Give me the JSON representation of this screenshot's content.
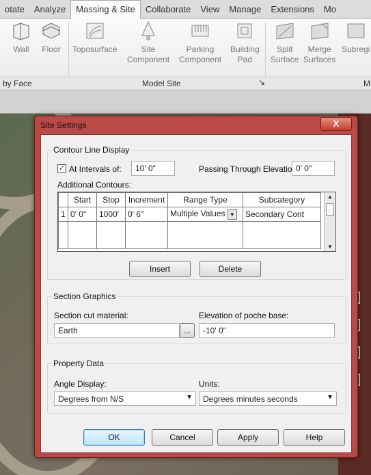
{
  "ribbon": {
    "tabs": [
      "otate",
      "Analyze",
      "Massing & Site",
      "Collaborate",
      "View",
      "Manage",
      "Extensions",
      "Mo"
    ],
    "buttons": {
      "wall": [
        "Wall",
        ""
      ],
      "floor": [
        "Floor",
        ""
      ],
      "toposurface": [
        "Toposurface",
        ""
      ],
      "site_component": [
        "Site",
        "Component"
      ],
      "parking_component": [
        "Parking",
        "Component"
      ],
      "building_pad": [
        "Building",
        "Pad"
      ],
      "split_surface": [
        "Split",
        "Surface"
      ],
      "merge_surfaces": [
        "Merge",
        "Surfaces"
      ],
      "subregion": [
        "Subregi",
        ""
      ]
    },
    "panels": {
      "by_face": "by Face",
      "model_site": "Model Site",
      "m": "M"
    }
  },
  "dialog": {
    "title": "Site Settings",
    "close": "X",
    "contour": {
      "group_title": "Contour Line Display",
      "at_intervals_checked": "✓",
      "at_intervals_label": "At Intervals of:",
      "interval_value": "10'  0\"",
      "passing_label": "Passing Through Elevation:",
      "passing_value": "0'  0\"",
      "additional_label": "Additional Contours:",
      "table": {
        "headers": [
          "",
          "Start",
          "Stop",
          "Increment",
          "Range Type",
          "Subcategory"
        ],
        "row": [
          "1",
          "0'  0\"",
          "1000'",
          "0'  6\"",
          "Multiple Values",
          "Secondary Cont"
        ]
      },
      "insert": "Insert",
      "delete": "Delete"
    },
    "section": {
      "group_title": "Section Graphics",
      "cut_label": "Section cut material:",
      "cut_value": "Earth",
      "browse": "...",
      "poche_label": "Elevation of poche base:",
      "poche_value": "-10'  0\""
    },
    "property": {
      "group_title": "Property Data",
      "angle_label": "Angle Display:",
      "angle_value": "Degrees from N/S",
      "units_label": "Units:",
      "units_value": "Degrees minutes seconds"
    },
    "buttons": {
      "ok": "OK",
      "cancel": "Cancel",
      "apply": "Apply",
      "help": "Help"
    }
  },
  "colors": {
    "dialog_frame": "#b94a45",
    "ok_border": "#3c7fb1",
    "dialog_body": "#f0f0f0"
  }
}
